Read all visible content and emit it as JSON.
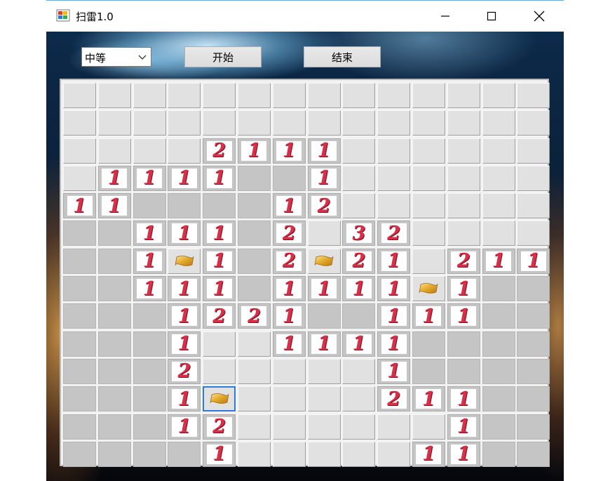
{
  "window": {
    "title": "扫雷1.0"
  },
  "controls": {
    "difficulty_value": "中等",
    "start_label": "开始",
    "end_label": "结束"
  },
  "colors": {
    "number": "#d9304a",
    "flag": "#e2a82a",
    "selection": "#2e7ad8"
  },
  "board": {
    "rows": 14,
    "cols": 14,
    "legend": {
      "closed": "closed cell",
      "open": "open empty cell",
      "F": "flag",
      "digits": "mine count"
    },
    "cells": [
      [
        "C",
        "C",
        "C",
        "C",
        "C",
        "C",
        "C",
        "C",
        "C",
        "C",
        "C",
        "C",
        "C",
        "C"
      ],
      [
        "C",
        "C",
        "C",
        "C",
        "C",
        "C",
        "C",
        "C",
        "C",
        "C",
        "C",
        "C",
        "C",
        "C"
      ],
      [
        "C",
        "C",
        "C",
        "C",
        "2",
        "1",
        "1",
        "1",
        "C",
        "C",
        "C",
        "C",
        "C",
        "C"
      ],
      [
        "C",
        "1",
        "1",
        "1",
        "1",
        "O",
        "O",
        "1",
        "C",
        "C",
        "C",
        "C",
        "C",
        "C"
      ],
      [
        "1",
        "1",
        "O",
        "O",
        "O",
        "O",
        "1",
        "2",
        "C",
        "C",
        "C",
        "C",
        "C",
        "C"
      ],
      [
        "O",
        "O",
        "1",
        "1",
        "1",
        "O",
        "2",
        "C",
        "3",
        "2",
        "C",
        "C",
        "C",
        "C"
      ],
      [
        "O",
        "O",
        "1",
        "F",
        "1",
        "O",
        "2",
        "F",
        "2",
        "1",
        "C",
        "2",
        "1",
        "1"
      ],
      [
        "O",
        "O",
        "1",
        "1",
        "1",
        "O",
        "1",
        "1",
        "1",
        "1",
        "F",
        "1",
        "O",
        "O"
      ],
      [
        "O",
        "O",
        "O",
        "1",
        "2",
        "2",
        "1",
        "O",
        "O",
        "1",
        "1",
        "1",
        "O",
        "O"
      ],
      [
        "O",
        "O",
        "O",
        "1",
        "C",
        "C",
        "1",
        "1",
        "1",
        "1",
        "O",
        "O",
        "O",
        "O"
      ],
      [
        "O",
        "O",
        "O",
        "2",
        "C",
        "C",
        "C",
        "C",
        "C",
        "1",
        "O",
        "O",
        "O",
        "O"
      ],
      [
        "O",
        "O",
        "O",
        "1",
        "F",
        "C",
        "C",
        "C",
        "C",
        "2",
        "1",
        "1",
        "O",
        "O"
      ],
      [
        "O",
        "O",
        "O",
        "1",
        "2",
        "C",
        "C",
        "C",
        "C",
        "C",
        "C",
        "1",
        "O",
        "O"
      ],
      [
        "O",
        "O",
        "O",
        "O",
        "1",
        "C",
        "C",
        "C",
        "C",
        "C",
        "1",
        "1",
        "O",
        "O"
      ]
    ],
    "selected": {
      "row": 11,
      "col": 4
    }
  }
}
